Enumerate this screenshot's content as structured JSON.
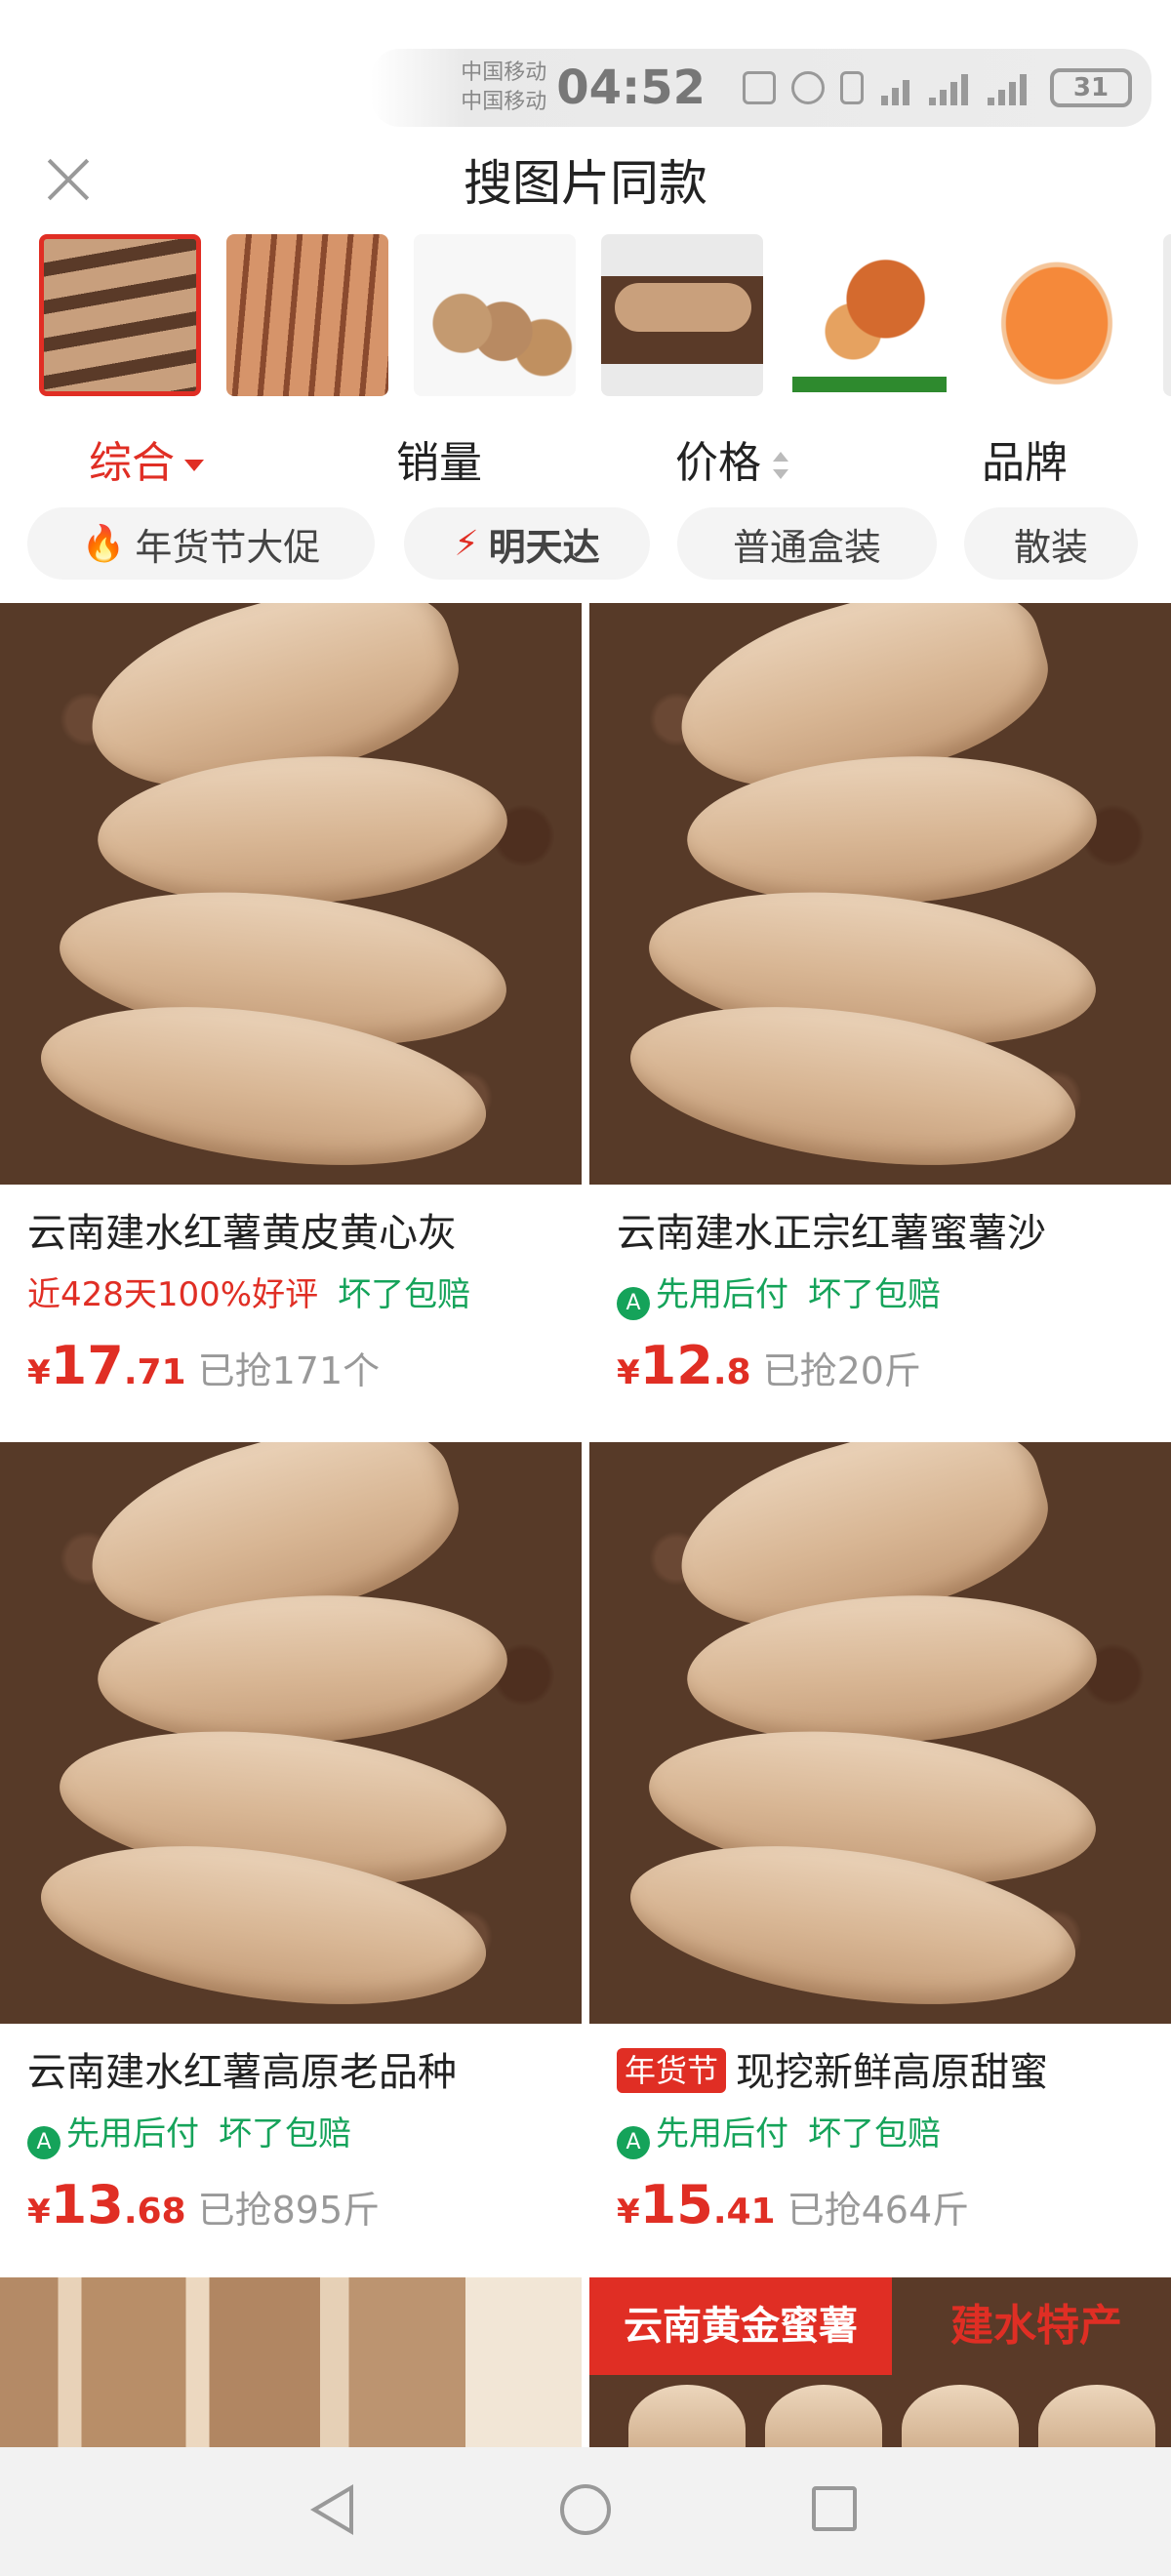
{
  "status_bar": {
    "carrier_1": "中国移动",
    "carrier_2": "中国移动",
    "time": "04:52",
    "battery": "31",
    "icons": [
      "nfc-icon",
      "alarm-icon",
      "vibrate-icon",
      "wifi-6-icon",
      "signal-4g-icon",
      "signal-4g-icon",
      "battery-icon"
    ]
  },
  "header": {
    "title": "搜图片同款",
    "close_icon": "close-icon"
  },
  "thumbnails": {
    "selected_index": 0,
    "items": [
      "sweet-potatoes-on-soil",
      "sweet-potatoes-pile",
      "sweet-potatoes-white-bg",
      "sweet-potato-single",
      "yunnan-yellow-heart-potato",
      "cut-sweet-potato",
      "partial"
    ]
  },
  "sort_tabs": {
    "items": [
      {
        "label": "综合",
        "active": true
      },
      {
        "label": "销量",
        "active": false
      },
      {
        "label": "价格",
        "active": false
      },
      {
        "label": "品牌",
        "active": false
      }
    ]
  },
  "filter_chips": {
    "items": [
      {
        "label": "年货节大促",
        "icon": "fire-icon"
      },
      {
        "label": "明天达",
        "icon": "lightning-icon"
      },
      {
        "label": "普通盒装",
        "icon": ""
      },
      {
        "label": "散装",
        "icon": ""
      }
    ]
  },
  "products": [
    {
      "title": "云南建水红薯黄皮黄心灰",
      "festival_badge": "",
      "tags": [
        {
          "text": "近428天100%好评",
          "color": "red"
        },
        {
          "text": "坏了包赔",
          "color": "green"
        }
      ],
      "price_symbol": "¥",
      "price_int": "17",
      "price_dec": ".71",
      "sold": "已抢171个"
    },
    {
      "title": "云南建水正宗红薯蜜薯沙",
      "festival_badge": "",
      "tags": [
        {
          "text": "先用后付",
          "color": "green",
          "icon": "pay-later-icon"
        },
        {
          "text": "坏了包赔",
          "color": "green"
        }
      ],
      "price_symbol": "¥",
      "price_int": "12",
      "price_dec": ".8",
      "sold": "已抢20斤"
    },
    {
      "title": "云南建水红薯高原老品种",
      "festival_badge": "",
      "tags": [
        {
          "text": "先用后付",
          "color": "green",
          "icon": "pay-later-icon"
        },
        {
          "text": "坏了包赔",
          "color": "green"
        }
      ],
      "price_symbol": "¥",
      "price_int": "13",
      "price_dec": ".68",
      "sold": "已抢895斤"
    },
    {
      "title": "现挖新鲜高原甜蜜",
      "festival_badge": "年货节",
      "tags": [
        {
          "text": "先用后付",
          "color": "green",
          "icon": "pay-later-icon"
        },
        {
          "text": "坏了包赔",
          "color": "green"
        }
      ],
      "price_symbol": "¥",
      "price_int": "15",
      "price_dec": ".41",
      "sold": "已抢464斤"
    }
  ],
  "partial_cards": {
    "banner_left": "云南黄金蜜薯",
    "banner_right": "建水特产"
  },
  "colors": {
    "accent_red": "#e02e24",
    "green": "#15a35a",
    "muted": "#999999"
  },
  "nav_bar": {
    "icons": [
      "back-icon",
      "home-icon",
      "recent-apps-icon"
    ]
  }
}
